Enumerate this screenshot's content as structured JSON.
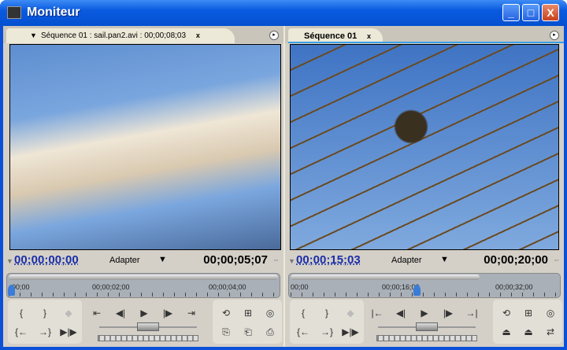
{
  "window": {
    "title": "Moniteur",
    "minimize": "_",
    "maximize": "□",
    "close": "X"
  },
  "source": {
    "tab_arrow": "▼",
    "tab_label": "Séquence 01 : sail.pan2.avi : 00;00;08;03",
    "tab_close": "x",
    "menu": "▸",
    "timecode_current": "00;00;00;00",
    "fit": "Adapter",
    "fit_arrow": "▼",
    "timecode_duration": "00;00;05;07",
    "ruler_labels": [
      "00;00",
      "00;00;02;00",
      "00;00;04;00"
    ],
    "playhead_fraction": 0.0,
    "buttons": {
      "mark_in": "{",
      "mark_out": "}",
      "set_marker": "◆",
      "goto_in": "{←",
      "goto_out": "→}",
      "play_in_out": "▶|▶",
      "step_to_in": "⇤",
      "step_back": "◀|",
      "play": "▶",
      "step_forward": "|▶",
      "step_to_out": "⇥",
      "loop": "⟲",
      "safe_margins": "⊞",
      "output": "◎",
      "insert": "⎘",
      "overlay": "⎗",
      "export_frame": "⎙"
    }
  },
  "program": {
    "tab_label": "Séquence 01",
    "tab_close": "x",
    "menu": "▸",
    "timecode_current": "00;00;15;03",
    "fit": "Adapter",
    "fit_arrow": "▼",
    "timecode_duration": "00;00;20;00",
    "ruler_labels": [
      "00;00",
      "00;00;16;00",
      "00;00;32;00"
    ],
    "playhead_fraction": 0.47,
    "buttons": {
      "mark_in": "{",
      "mark_out": "}",
      "set_marker": "◆",
      "goto_in": "{←",
      "goto_out": "→}",
      "play_in_out": "▶|▶",
      "step_to_in": "|←",
      "step_back": "◀|",
      "play": "▶",
      "step_forward": "|▶",
      "step_to_out": "→|",
      "loop": "⟲",
      "safe_margins": "⊞",
      "output": "◎",
      "lift": "⏏",
      "extract": "⏏",
      "trim": "⇄"
    }
  }
}
